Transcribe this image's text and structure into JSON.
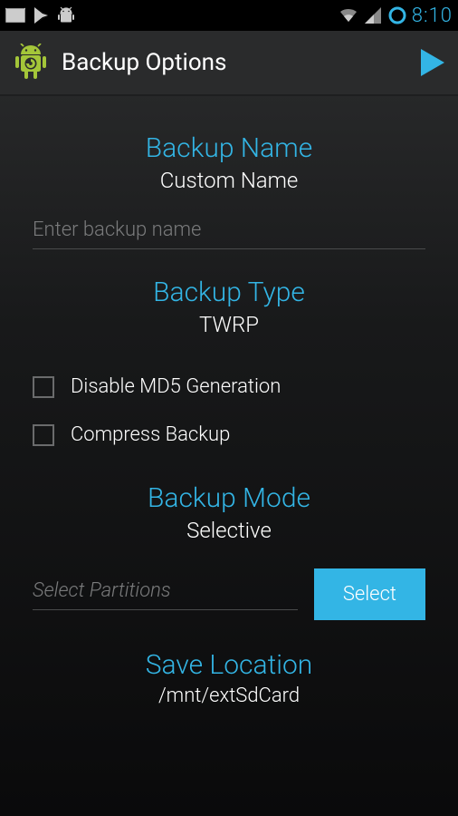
{
  "status_bar": {
    "time": "8:10"
  },
  "action_bar": {
    "title": "Backup Options"
  },
  "sections": {
    "backup_name": {
      "title": "Backup Name",
      "subtitle": "Custom Name",
      "input_placeholder": "Enter backup name",
      "input_value": ""
    },
    "backup_type": {
      "title": "Backup Type",
      "subtitle": "TWRP",
      "checkbox_md5": "Disable MD5 Generation",
      "checkbox_compress": "Compress Backup"
    },
    "backup_mode": {
      "title": "Backup Mode",
      "subtitle": "Selective",
      "partition_placeholder": "Select Partitions",
      "partition_value": "",
      "select_button": "Select"
    },
    "save_location": {
      "title": "Save Location",
      "path": "/mnt/extSdCard"
    }
  }
}
